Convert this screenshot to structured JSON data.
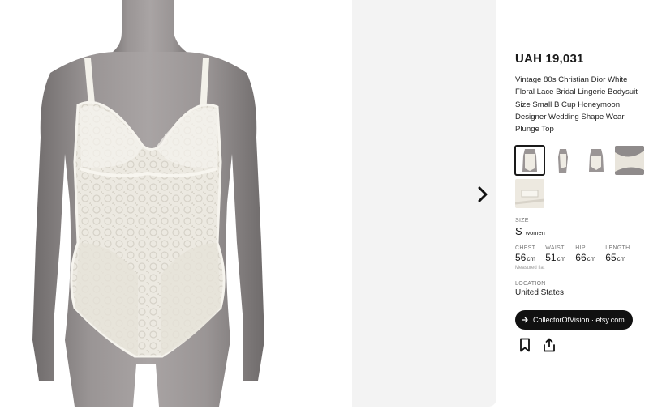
{
  "gallery": {
    "main_image": "lingerie-bodysuit-on-mannequin",
    "next_icon": "chevron-right-icon"
  },
  "product": {
    "price": "UAH 19,031",
    "title": "Vintage 80s Christian Dior White Floral Lace Bridal Lingerie Bodysuit Size Small B Cup Honeymoon Designer Wedding Shape Wear Plunge Top",
    "thumbnails": [
      "bodysuit-front",
      "bodysuit-side",
      "bodysuit-back",
      "lace-detail",
      "label-tag"
    ],
    "selected_thumbnail": 0
  },
  "size": {
    "label": "SIZE",
    "value": "S",
    "unit": "women"
  },
  "measurements": {
    "items": [
      {
        "label": "CHEST",
        "value": "56",
        "unit": "cm"
      },
      {
        "label": "WAIST",
        "value": "51",
        "unit": "cm"
      },
      {
        "label": "HIP",
        "value": "66",
        "unit": "cm"
      },
      {
        "label": "LENGTH",
        "value": "65",
        "unit": "cm"
      }
    ],
    "note": "Measured flat"
  },
  "location": {
    "label": "LOCATION",
    "value": "United States"
  },
  "shop": {
    "label": "CollectorOfVision · etsy.com",
    "icon": "arrow-right-icon"
  },
  "actions": {
    "bookmark_icon": "bookmark-icon",
    "share_icon": "share-icon"
  },
  "colors": {
    "button_bg": "#111111",
    "gallery_bg": "#f3f3f3",
    "mannequin": "#8e8a8a",
    "lace": "#f1efe8"
  }
}
